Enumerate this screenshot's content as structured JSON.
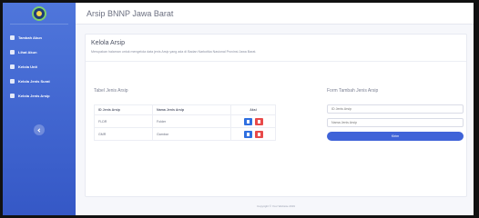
{
  "app": {
    "title": "Arsip BNNP Jawa Barat"
  },
  "sidebar": {
    "items": [
      {
        "label": "Tambah Akun",
        "icon": "user-plus-icon"
      },
      {
        "label": "Lihat Akun",
        "icon": "users-icon"
      },
      {
        "label": "Kelola Unit",
        "icon": "folder-icon"
      },
      {
        "label": "Kelola Jenis Surat",
        "icon": "mail-icon"
      },
      {
        "label": "Kelola Jenis Arsip",
        "icon": "archive-icon"
      }
    ]
  },
  "page": {
    "title": "Kelola Arsip",
    "description": "Merupakan halaman untuk mengelola data jenis Arsip yang ada di Badan Narkotika Nasional Provinsi Jawa Barat."
  },
  "table": {
    "title": "Tabel Jenis Arsip",
    "headers": [
      "ID Jenis Arsip",
      "Nama Jenis Arsip",
      "Aksi"
    ],
    "rows": [
      {
        "id": "FLDR",
        "name": "Folder"
      },
      {
        "id": "GMR",
        "name": "Gambar"
      }
    ]
  },
  "form": {
    "title": "Form Tambah Jenis Arsip",
    "id_placeholder": "ID Jenis Arsip",
    "name_placeholder": "Nama Jenis Arsip",
    "submit_label": "Kirim"
  },
  "footer": {
    "text": "Copyright © Your Website 2019"
  },
  "colors": {
    "sidebar": "#4169d6",
    "primary": "#3f63d8",
    "danger": "#e84a4a",
    "edit": "#2f6fe0"
  }
}
